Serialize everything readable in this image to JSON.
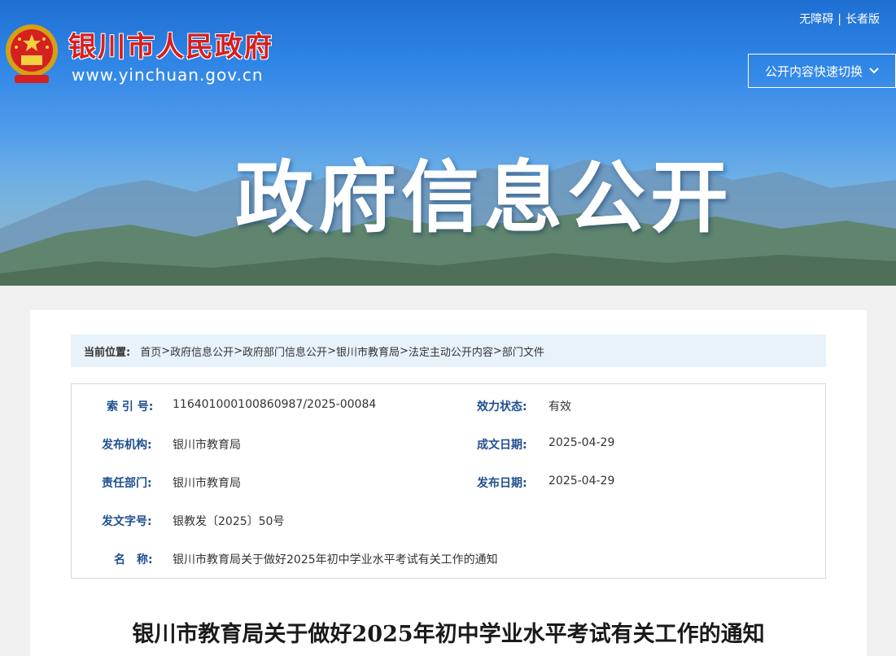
{
  "header": {
    "site_name": "银川市人民政府",
    "site_url": "www.yinchuan.gov.cn",
    "accessibility": "无障碍",
    "separator": "|",
    "elder_mode": "长者版",
    "quick_switch": "公开内容快速切换",
    "hero_title": "政府信息公开",
    "colors": {
      "banner_top": "#1f6fd3",
      "site_name": "#d61f1f"
    }
  },
  "breadcrumb": {
    "label": "当前位置:",
    "items": [
      "首页",
      "政府信息公开",
      "政府部门信息公开",
      "银川市教育局",
      "法定主动公开内容",
      "部门文件"
    ],
    "separator": ">"
  },
  "meta": {
    "index_label": "索 引 号:",
    "index_value": "11640100010086098​7/2025-00084",
    "status_label": "效力状态:",
    "status_value": "有效",
    "publisher_label": "发布机构:",
    "publisher_value": "银川市教育局",
    "created_label": "成文日期:",
    "created_value": "2025-04-29",
    "dept_label": "责任部门:",
    "dept_value": "银川市教育局",
    "published_label": "发布日期:",
    "published_value": "2025-04-29",
    "docno_label": "发文字号:",
    "docno_value": "银教发〔2025〕50号",
    "name_label": "名　称:",
    "name_value": "银川市教育局关于做好2025年初中学业水平考试有关工作的通知"
  },
  "document": {
    "title": "银川市教育局关于做好2025年初中学业水平考试有关工作的通知"
  }
}
